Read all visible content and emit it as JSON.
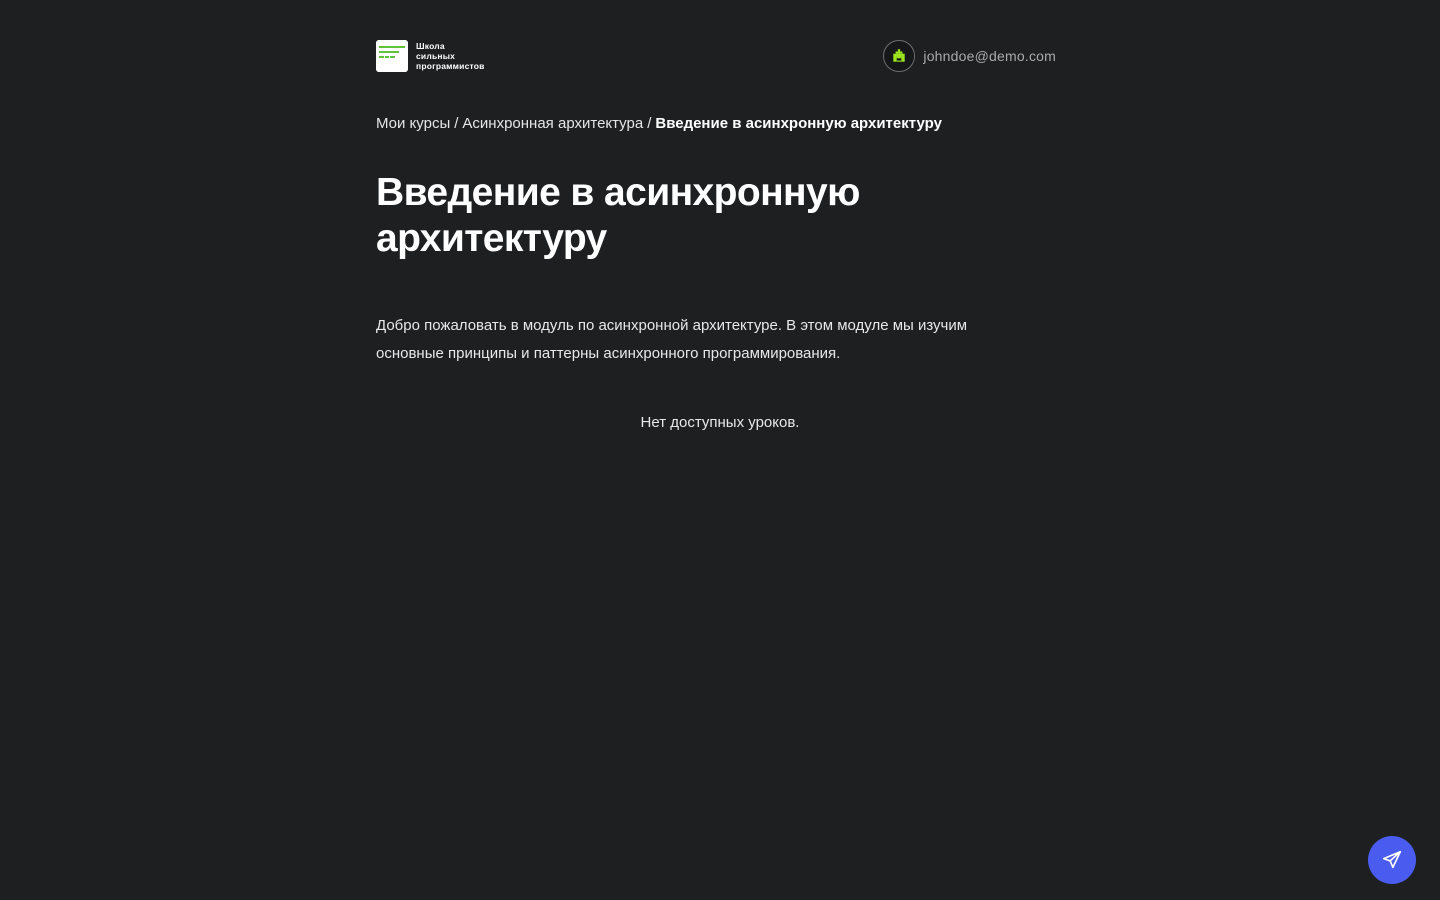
{
  "header": {
    "logo_lines": [
      "Школа",
      "сильных",
      "программистов"
    ],
    "user_email": "johndoe@demo.com",
    "avatar_icon": "pixel-house-icon"
  },
  "breadcrumb": {
    "items": [
      {
        "label": "Мои курсы"
      },
      {
        "label": "Асинхронная архитектура"
      }
    ],
    "separator": "/",
    "current": "Введение в асинхронную архитектуру"
  },
  "main": {
    "title": "Введение в асинхронную архитектуру",
    "description": "Добро пожаловать в модуль по асинхронной архитектуре. В этом модуле мы изучим основные принципы и паттерны асинхронного программирования.",
    "empty_state": "Нет доступных уроков."
  },
  "fab": {
    "icon": "paper-plane-icon"
  },
  "colors": {
    "background": "#1d1f20",
    "accent": "#4a5cf0",
    "logo_green": "#5ec33a",
    "avatar_green": "#9be41e"
  }
}
